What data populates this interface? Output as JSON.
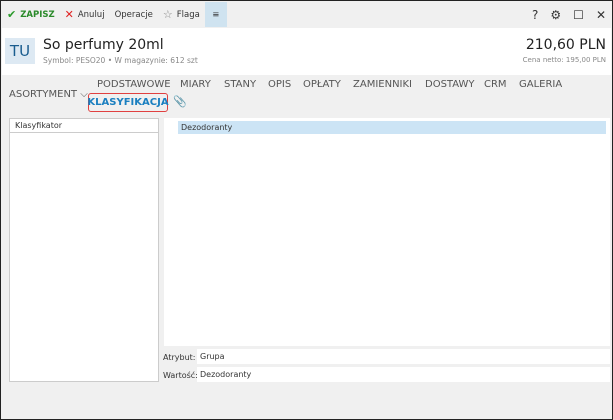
{
  "toolbar": {
    "save": "ZAPISZ",
    "cancel": "Anuluj",
    "operations": "Operacje",
    "flag": "Flaga",
    "menu": "≡",
    "help": "?"
  },
  "header": {
    "avatar": "TU",
    "title": "So perfumy 20ml",
    "subtitle": "Symbol: PESO20 • W magazynie: 612 szt",
    "price": "210,60 PLN",
    "net_price": "Cena netto: 195,00 PLN"
  },
  "tabs": {
    "assortment": "ASORTYMENT",
    "items": [
      "PODSTAWOWE",
      "MIARY",
      "STANY",
      "OPIS",
      "OPŁATY",
      "ZAMIENNIKI",
      "DOSTAWY",
      "CRM",
      "GALERIA"
    ],
    "active": "KLASYFIKACJA"
  },
  "left_panel": {
    "header": "Klasyfikator"
  },
  "right_panel": {
    "selected_row": "Dezodoranty"
  },
  "fields": {
    "attribute_label": "Atrybut:",
    "attribute_value": "Grupa",
    "value_label": "Wartość:",
    "value_value": "Dezodoranty"
  }
}
